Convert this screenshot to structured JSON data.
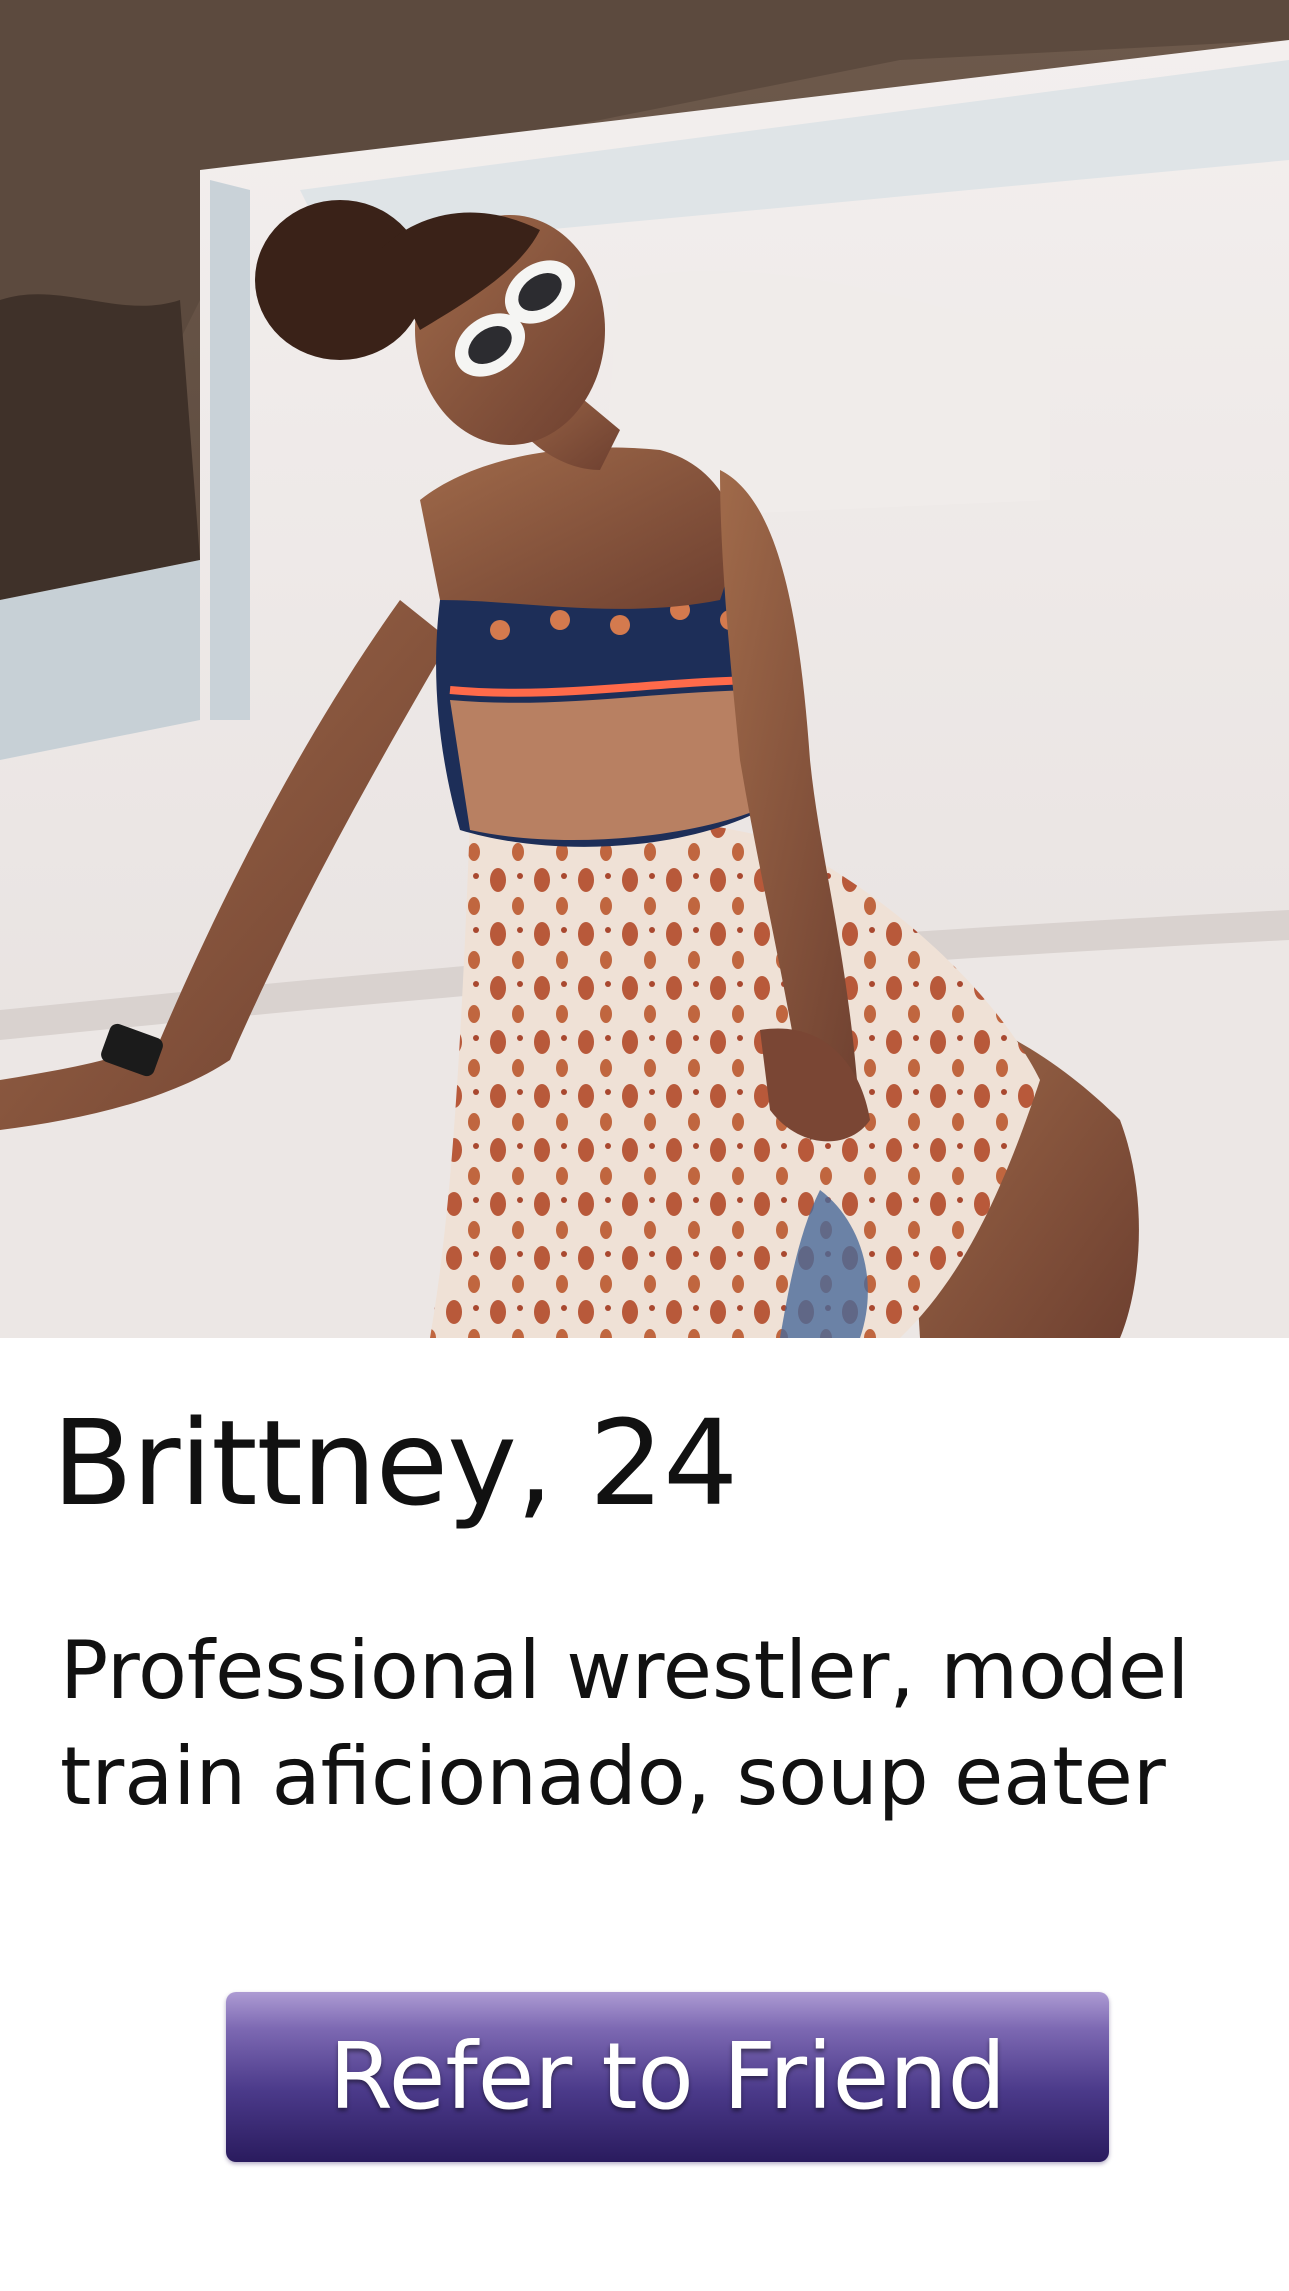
{
  "profile": {
    "photo_subject": "woman in patterned sundress and white sunglasses seated on a white rooftop",
    "name_age": "Brittney, 24",
    "bio_lines": [
      "Professional wrestler, model",
      "train aficionado, soup eater"
    ]
  },
  "actions": {
    "refer_label": "Refer to Friend"
  },
  "colors": {
    "button_top": "#ad9bd3",
    "button_bottom": "#2a1b5e",
    "text": "#111111",
    "background": "#ffffff"
  }
}
